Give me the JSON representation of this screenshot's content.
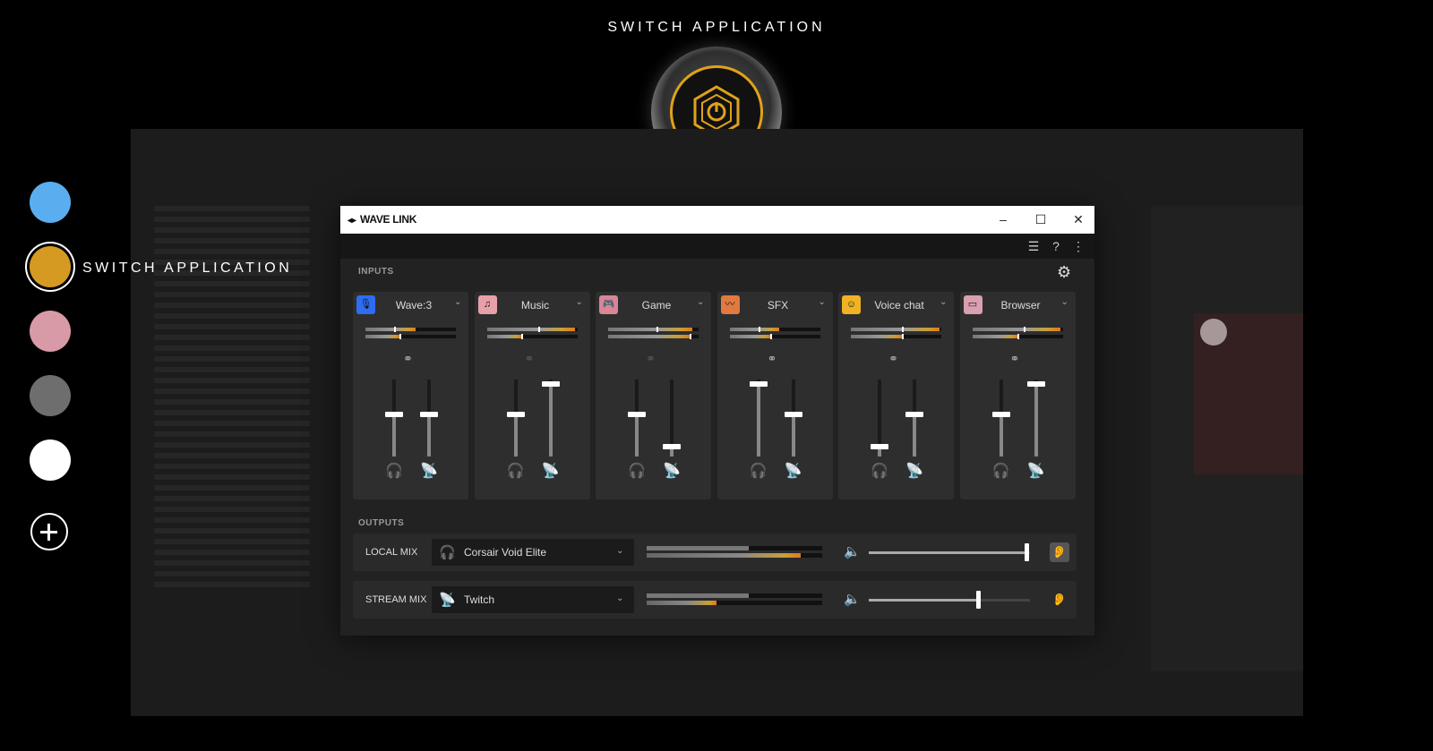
{
  "overlay": {
    "title": "SWITCH APPLICATION",
    "selected_label": "SWITCH APPLICATION",
    "app_slots": [
      {
        "name": "blue-app-slot",
        "color": "#5aaef0"
      },
      {
        "name": "gold-app-slot",
        "color": "#d49a22",
        "selected": true
      },
      {
        "name": "pink-app-slot",
        "color": "#d79aa6"
      },
      {
        "name": "gray-app-slot",
        "color": "#6e6e6e"
      },
      {
        "name": "white-app-slot",
        "color": "#ffffff"
      }
    ],
    "knob_accent": "#e0a21a"
  },
  "window": {
    "title": "WAVE LINK",
    "controls": [
      "minimize",
      "maximize",
      "close"
    ]
  },
  "inputs": {
    "label": "INPUTS",
    "channels": [
      {
        "name": "Wave:3",
        "icon": "microphone-icon",
        "color": "#2f6df0",
        "linked": true,
        "meter1": 0.55,
        "meter2": 0.38,
        "monitor_level": 0.55,
        "stream_level": 0.55
      },
      {
        "name": "Music",
        "icon": "music-icon",
        "color": "#e8a0a8",
        "linked": false,
        "meter1": 0.98,
        "meter2": 0.38,
        "monitor_level": 0.55,
        "stream_level": 0.98
      },
      {
        "name": "Game",
        "icon": "gamepad-icon",
        "color": "#d9869a",
        "linked": false,
        "meter1": 0.93,
        "meter2": 0.9,
        "monitor_level": 0.55,
        "stream_level": 0.1
      },
      {
        "name": "SFX",
        "icon": "sound-wave-icon",
        "color": "#e07a40",
        "linked": true,
        "meter1": 0.55,
        "meter2": 0.45,
        "monitor_level": 0.98,
        "stream_level": 0.55
      },
      {
        "name": "Voice chat",
        "icon": "chat-icon",
        "color": "#f0b323",
        "linked": true,
        "meter1": 0.98,
        "meter2": 0.56,
        "monitor_level": 0.1,
        "stream_level": 0.55
      },
      {
        "name": "Browser",
        "icon": "browser-icon",
        "color": "#d9a0b0",
        "linked": true,
        "meter1": 0.98,
        "meter2": 0.5,
        "monitor_level": 0.55,
        "stream_level": 0.98
      }
    ]
  },
  "outputs": {
    "label": "OUTPUTS",
    "mixes": [
      {
        "label": "LOCAL MIX",
        "device": "Corsair Void Elite",
        "device_icon": "headphones-icon",
        "meter1": 0.58,
        "meter2": 0.88,
        "volume": 0.98,
        "end_icon": "ear-icon"
      },
      {
        "label": "STREAM MIX",
        "device": "Twitch",
        "device_icon": "broadcast-icon",
        "meter1": 0.58,
        "meter2": 0.4,
        "volume": 0.68,
        "end_icon": "ear-icon"
      }
    ]
  }
}
